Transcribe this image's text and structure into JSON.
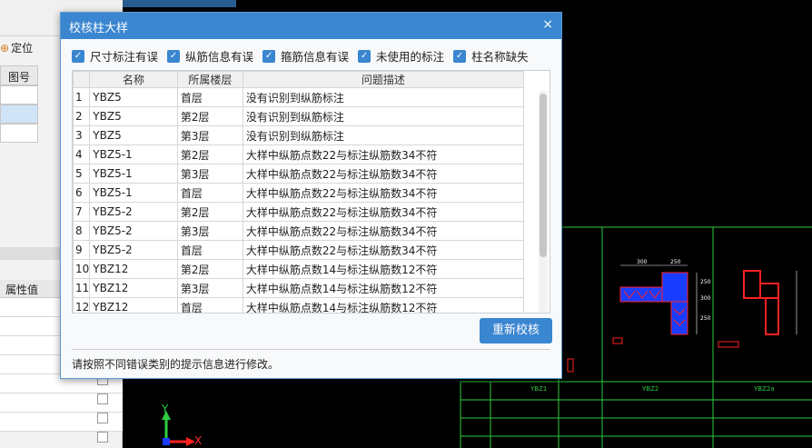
{
  "dialog": {
    "title": "校核柱大样",
    "close": "×",
    "filters": [
      {
        "label": "尺寸标注有误",
        "checked": true
      },
      {
        "label": "纵筋信息有误",
        "checked": true
      },
      {
        "label": "箍筋信息有误",
        "checked": true
      },
      {
        "label": "未使用的标注",
        "checked": true
      },
      {
        "label": "柱名称缺失",
        "checked": true
      }
    ],
    "columns": [
      "名称",
      "所属楼层",
      "问题描述"
    ],
    "rows": [
      {
        "idx": "1",
        "name": "YBZ5",
        "floor": "首层",
        "desc": "没有识别到纵筋标注"
      },
      {
        "idx": "2",
        "name": "YBZ5",
        "floor": "第2层",
        "desc": "没有识别到纵筋标注"
      },
      {
        "idx": "3",
        "name": "YBZ5",
        "floor": "第3层",
        "desc": "没有识别到纵筋标注"
      },
      {
        "idx": "4",
        "name": "YBZ5-1",
        "floor": "第2层",
        "desc": "大样中纵筋点数22与标注纵筋数34不符"
      },
      {
        "idx": "5",
        "name": "YBZ5-1",
        "floor": "第3层",
        "desc": "大样中纵筋点数22与标注纵筋数34不符"
      },
      {
        "idx": "6",
        "name": "YBZ5-1",
        "floor": "首层",
        "desc": "大样中纵筋点数22与标注纵筋数34不符"
      },
      {
        "idx": "7",
        "name": "YBZ5-2",
        "floor": "第2层",
        "desc": "大样中纵筋点数22与标注纵筋数34不符"
      },
      {
        "idx": "8",
        "name": "YBZ5-2",
        "floor": "第3层",
        "desc": "大样中纵筋点数22与标注纵筋数34不符"
      },
      {
        "idx": "9",
        "name": "YBZ5-2",
        "floor": "首层",
        "desc": "大样中纵筋点数22与标注纵筋数34不符"
      },
      {
        "idx": "10",
        "name": "YBZ12",
        "floor": "第2层",
        "desc": "大样中纵筋点数14与标注纵筋数12不符"
      },
      {
        "idx": "11",
        "name": "YBZ12",
        "floor": "第3层",
        "desc": "大样中纵筋点数14与标注纵筋数12不符"
      },
      {
        "idx": "12",
        "name": "YBZ12",
        "floor": "首层",
        "desc": "大样中纵筋点数14与标注纵筋数12不符"
      }
    ],
    "recheck_button": "重新校核",
    "hint": "请按照不同错误类别的提示信息进行修改。"
  },
  "left_panel": {
    "locate_label": "定位",
    "grid_header": "图号",
    "attr_header": "属性值"
  },
  "cad": {
    "axis_y": "Y",
    "axis_x": "X",
    "col_labels": [
      "YBZ1",
      "YBZ2",
      "YBZ2a"
    ],
    "dims_top": [
      "300",
      "250"
    ],
    "dims_right": [
      "250",
      "300",
      "250"
    ]
  },
  "colors": {
    "accent": "#3a86d0",
    "cad_line": "#2ecc40",
    "cad_red": "#ff2020",
    "cad_blue": "#1a3cff"
  }
}
